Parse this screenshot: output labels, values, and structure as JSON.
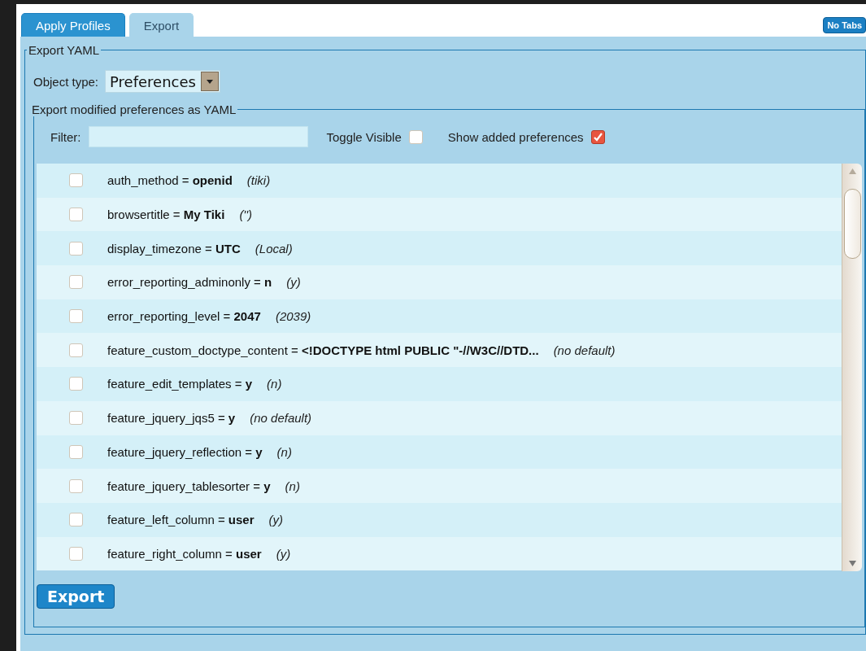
{
  "tabs": [
    {
      "label": "Apply Profiles",
      "selected": false
    },
    {
      "label": "Export",
      "selected": true
    }
  ],
  "no_tabs_button": "No Tabs",
  "export_yaml": {
    "legend": "Export YAML",
    "object_type": {
      "label": "Object type:",
      "value": "Preferences"
    },
    "modified": {
      "legend": "Export modified preferences as YAML",
      "filter": {
        "label": "Filter:"
      },
      "toggle_visible": {
        "label": "Toggle Visible",
        "checked": false
      },
      "show_added": {
        "label": "Show added preferences",
        "checked": true
      },
      "rows": [
        {
          "setting": "auth_method = **openid**",
          "default": "(tiki)",
          "checked": false
        },
        {
          "setting": "browsertitle = **My Tiki**",
          "default": "('')",
          "checked": false
        },
        {
          "setting": "display_timezone = **UTC**",
          "default": "(Local)",
          "checked": false
        },
        {
          "setting": "error_reporting_adminonly = **n**",
          "default": "(y)",
          "checked": false
        },
        {
          "setting": "error_reporting_level = **2047**",
          "default": "(2039)",
          "checked": false
        },
        {
          "setting": "feature_custom_doctype_content = **<!DOCTYPE html PUBLIC \"-//W3C//DTD...**",
          "default": "(no default)",
          "checked": false
        },
        {
          "setting": "feature_edit_templates = **y**",
          "default": "(n)",
          "checked": false
        },
        {
          "setting": "feature_jquery_jqs5 = **y**",
          "default": "(no default)",
          "checked": false
        },
        {
          "setting": "feature_jquery_reflection = **y**",
          "default": "(n)",
          "checked": false
        },
        {
          "setting": "feature_jquery_tablesorter = **y**",
          "default": "(n)",
          "checked": false
        },
        {
          "setting": "feature_left_column = **user**",
          "default": "(y)",
          "checked": false
        },
        {
          "setting": "feature_right_column = **user**",
          "default": "(y)",
          "checked": false
        }
      ]
    },
    "export_button": "Export"
  }
}
